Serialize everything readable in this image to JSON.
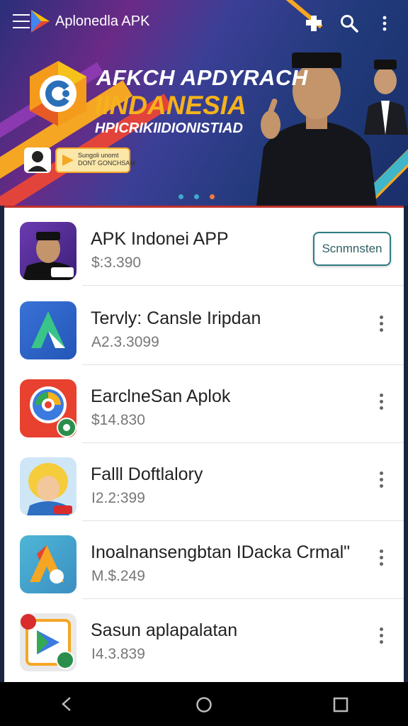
{
  "app_bar": {
    "title": "Aplonedla APK",
    "menu_icon": "hamburger-menu-icon",
    "logo_icon": "play-triangle-logo-icon",
    "actions": [
      "cross-icon",
      "search-icon",
      "overflow-menu-icon"
    ]
  },
  "banner": {
    "line1": "AFKCH APDYRACH",
    "line2": "IINDANESIA",
    "line3": "HPICRIKIIDIONISTIAD",
    "badge_text": "Sungoli unomt\nDONT GONCHSAM",
    "colors": {
      "accent": "#f5b21c",
      "purple": "#6a2a86",
      "blue": "#213a7a"
    },
    "carousel_dots": 3,
    "active_dot": 3
  },
  "apps": [
    {
      "title": "APK Indonei APP",
      "price": "$:3.390",
      "action": "Scnmnsten",
      "icon": "person-avatar-icon"
    },
    {
      "title": "Tervly: Cansle Iripdan",
      "price": "A2.3.3099",
      "icon": "blue-a-logo-icon"
    },
    {
      "title": "EarclneSan Aplok",
      "price": "$14.830",
      "icon": "red-map-pin-icon"
    },
    {
      "title": "Falll Doftlalory",
      "price": "I2.2:399",
      "icon": "cartoon-avatar-icon"
    },
    {
      "title": "Inoalnansengbtan IDacka Crmal\"",
      "price": "M.$.249",
      "icon": "teal-a-logo-icon"
    },
    {
      "title": "Sasun aplapalatan",
      "price": "I4.3.839",
      "icon": "play-store-icon"
    }
  ],
  "nav_bar": [
    "back-icon",
    "home-icon",
    "recents-icon"
  ]
}
